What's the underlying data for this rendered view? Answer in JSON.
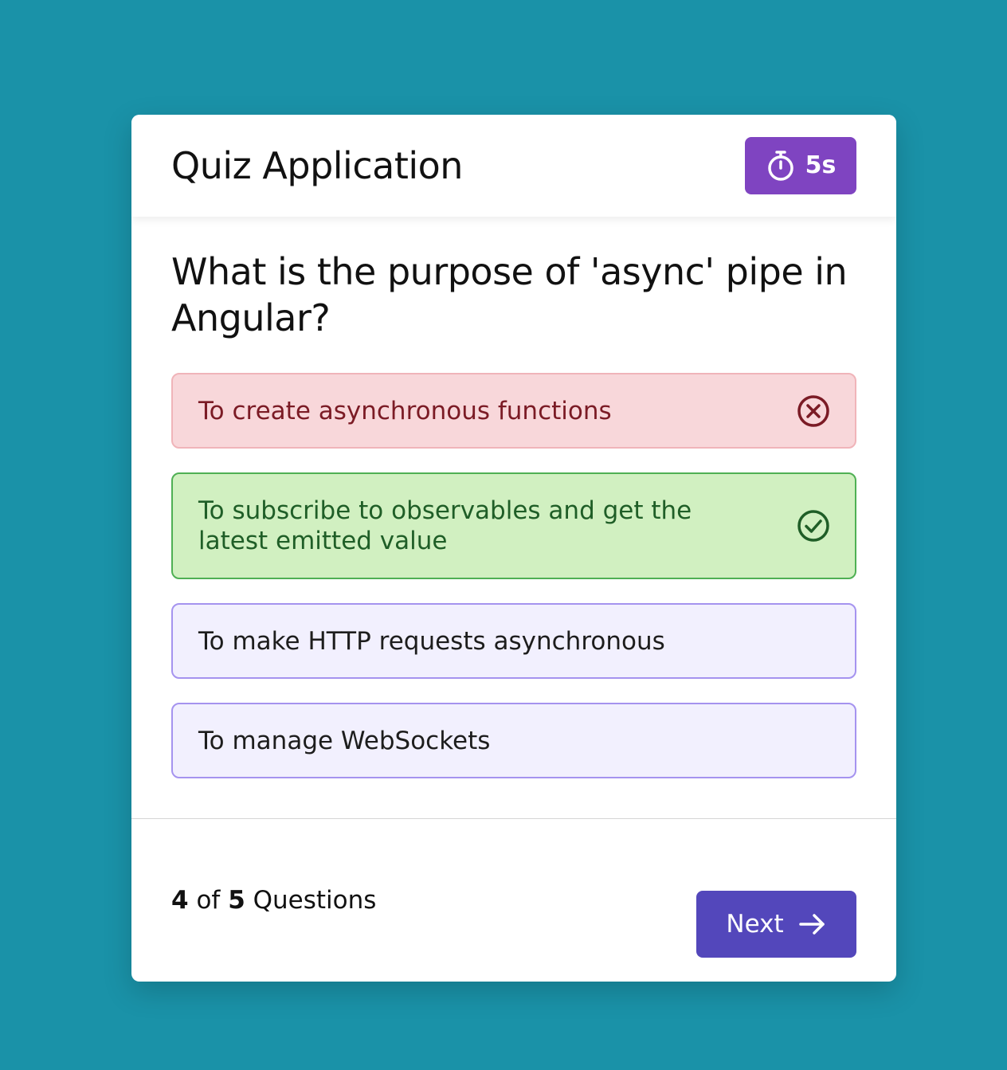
{
  "header": {
    "title": "Quiz Application",
    "timer_value": "5s",
    "timer_icon": "stopwatch-icon"
  },
  "question": {
    "text": "What is the purpose of 'async' pipe in Angular?"
  },
  "options": [
    {
      "label": "To create asynchronous functions",
      "state": "wrong",
      "icon": "x-circle-icon"
    },
    {
      "label": "To subscribe to observables and get the latest emitted value",
      "state": "correct",
      "icon": "check-circle-icon"
    },
    {
      "label": "To make HTTP requests asynchronous",
      "state": "default"
    },
    {
      "label": "To manage WebSockets",
      "state": "default"
    }
  ],
  "footer": {
    "current": "4",
    "of_text": "of",
    "total": "5",
    "questions_text": "Questions",
    "next_label": "Next",
    "next_icon": "arrow-right-icon"
  },
  "colors": {
    "background": "#1a92a8",
    "timer": "#7f44c1",
    "next_button": "#5347bb",
    "wrong_bg": "#f8d7da",
    "correct_bg": "#d1f0c1",
    "option_bg": "#f2f0fe",
    "option_border": "#a593ef"
  }
}
